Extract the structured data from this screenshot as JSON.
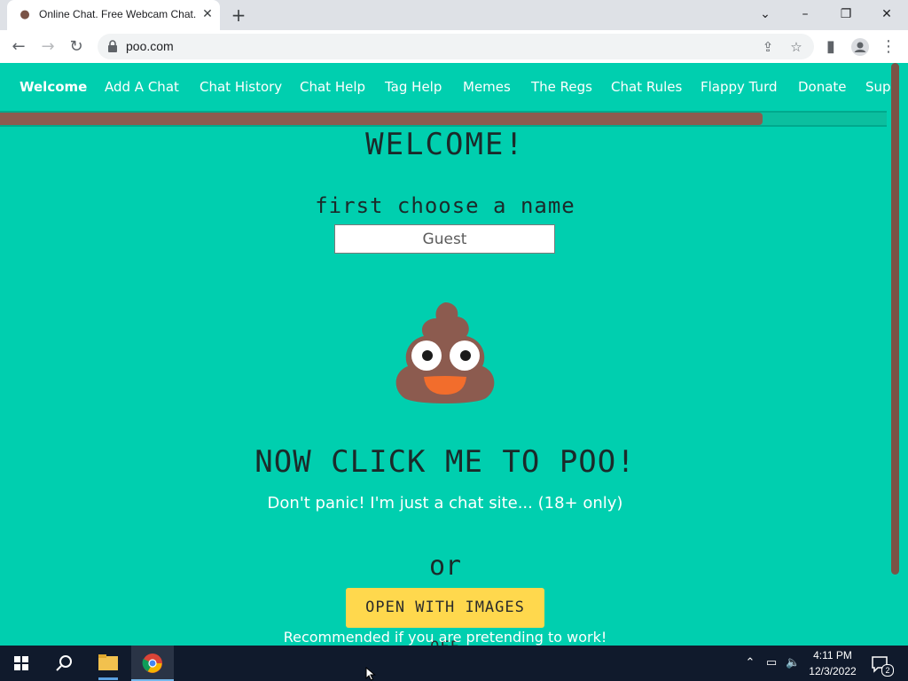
{
  "browser": {
    "tab_title": "Online Chat. Free Webcam Chat.",
    "tab_favicon": "poo-favicon-icon",
    "url": "poo.com"
  },
  "nav": {
    "items": [
      {
        "label": "Welcome",
        "active": true
      },
      {
        "label": "Add A Chat"
      },
      {
        "label": "Chat History"
      },
      {
        "label": "Chat Help"
      },
      {
        "label": "Tag Help"
      },
      {
        "label": "Memes"
      },
      {
        "label": "The Regs"
      },
      {
        "label": "Chat Rules"
      },
      {
        "label": "Flappy Turd"
      },
      {
        "label": "Donate"
      },
      {
        "label": "Sup"
      }
    ]
  },
  "progress": {
    "fraction": 0.86,
    "fill_color": "#8c5b4f"
  },
  "main": {
    "welcome": "WELCOME!",
    "choose_label": "first choose a name",
    "name_value": "Guest",
    "click_me": "NOW CLICK ME TO POO!",
    "dont_panic": "Don't panic! I'm just a chat site... (18+ only)",
    "or": "or",
    "images_off_button": "OPEN WITH IMAGES OFF",
    "recommended": "Recommended if you are pretending to work!"
  },
  "colors": {
    "page_bg": "#00cfaf",
    "brown": "#7a5346",
    "button_yellow": "#ffd84d"
  },
  "taskbar": {
    "time": "4:11 PM",
    "date": "12/3/2022",
    "notification_count": "2"
  }
}
